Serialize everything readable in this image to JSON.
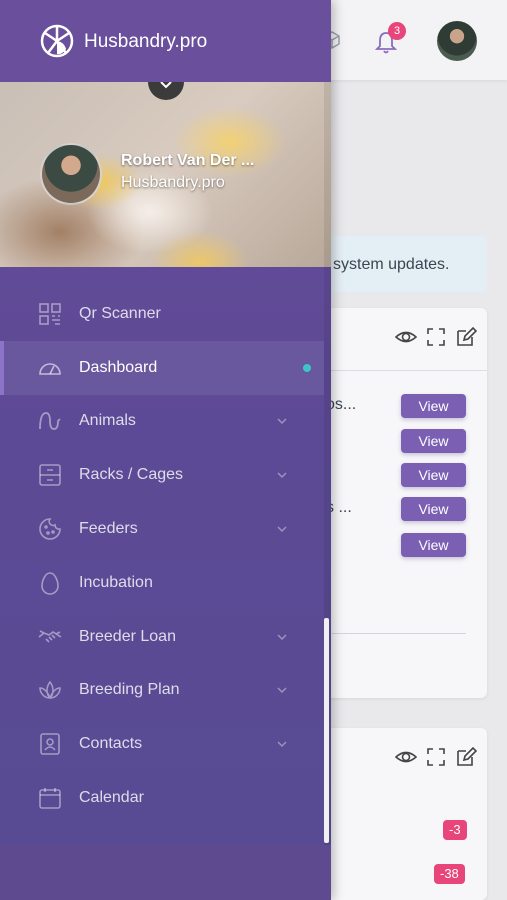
{
  "brand": {
    "name": "Husbandry.pro"
  },
  "header": {
    "notification_count": "3"
  },
  "profile": {
    "name": "Robert Van Der ...",
    "subtitle": "Husbandry.pro"
  },
  "menu": [
    {
      "label": "Qr Scanner",
      "icon": "qr-icon",
      "has_submenu": false
    },
    {
      "label": "Dashboard",
      "icon": "dashboard-icon",
      "active": true
    },
    {
      "label": "Animals",
      "icon": "snake-icon",
      "has_submenu": true
    },
    {
      "label": "Racks / Cages",
      "icon": "rack-icon",
      "has_submenu": true
    },
    {
      "label": "Feeders",
      "icon": "cookie-icon",
      "has_submenu": true
    },
    {
      "label": "Incubation",
      "icon": "egg-icon",
      "has_submenu": false
    },
    {
      "label": "Breeder Loan",
      "icon": "handshake-icon",
      "has_submenu": true
    },
    {
      "label": "Breeding Plan",
      "icon": "lotus-icon",
      "has_submenu": true
    },
    {
      "label": "Contacts",
      "icon": "contact-icon",
      "has_submenu": true
    },
    {
      "label": "Calendar",
      "icon": "calendar-icon",
      "has_submenu": false
    }
  ],
  "background": {
    "alert_text": "system updates.",
    "rows": [
      {
        "text": "os...",
        "button": "View"
      },
      {
        "text": "",
        "button": "View"
      },
      {
        "text": "",
        "button": "View"
      },
      {
        "text": "s ...",
        "button": "View"
      },
      {
        "text": "",
        "button": "View"
      }
    ],
    "badges": [
      "-3",
      "-38"
    ]
  },
  "colors": {
    "drawer": "#6a4f9c",
    "accent": "#7a5fb3",
    "badge": "#e8457a",
    "active_dot": "#3cc4c8"
  }
}
